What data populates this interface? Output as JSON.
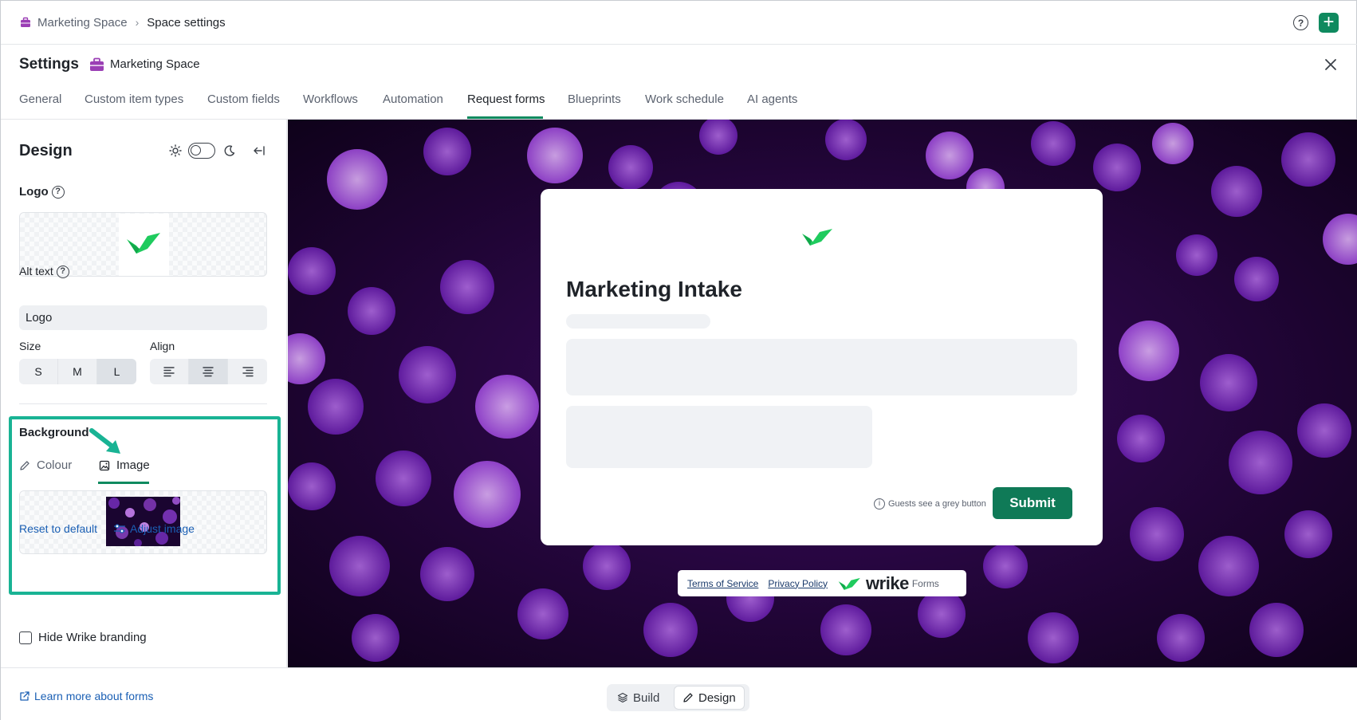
{
  "breadcrumb": {
    "space": "Marketing Space",
    "current": "Space settings"
  },
  "header": {
    "title": "Settings",
    "space": "Marketing Space"
  },
  "tabs": [
    {
      "label": "General"
    },
    {
      "label": "Custom item types"
    },
    {
      "label": "Custom fields"
    },
    {
      "label": "Workflows"
    },
    {
      "label": "Automation"
    },
    {
      "label": "Request forms",
      "active": true
    },
    {
      "label": "Blueprints"
    },
    {
      "label": "Work schedule"
    },
    {
      "label": "AI agents"
    }
  ],
  "design": {
    "title": "Design",
    "logo_label": "Logo",
    "alt_text_label": "Alt text",
    "alt_text_value": "Logo",
    "size_label": "Size",
    "sizes": [
      "S",
      "M",
      "L"
    ],
    "size_selected": "L",
    "align_label": "Align",
    "align_selected": "center",
    "background_label": "Background",
    "bg_tabs": {
      "colour": "Colour",
      "image": "Image",
      "active": "image"
    },
    "reset_label": "Reset to default",
    "adjust_label": "Adjust image",
    "hide_branding_label": "Hide Wrike branding",
    "hide_branding_checked": false
  },
  "preview": {
    "form_title": "Marketing Intake",
    "guest_note": "Guests see a grey button",
    "submit_label": "Submit",
    "footer": {
      "terms": "Terms of Service",
      "privacy": "Privacy Policy",
      "brand": "wrike",
      "suffix": "Forms"
    }
  },
  "bottom": {
    "learn_more": "Learn more about forms",
    "modes": [
      "Build",
      "Design"
    ],
    "mode_selected": "Design"
  },
  "colors": {
    "accent": "#0f8a5f",
    "highlight": "#19b394",
    "link": "#1a5fb4",
    "space_icon": "#9b3fb5",
    "wrike_green": "#1fcb5e"
  }
}
